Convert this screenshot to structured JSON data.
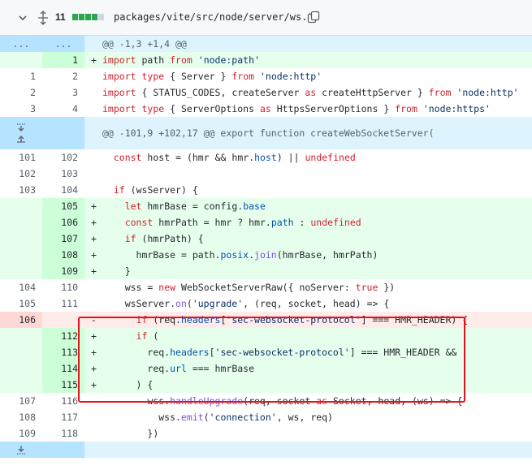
{
  "file": {
    "changed_count": "11",
    "diff_bar": [
      "green",
      "green",
      "green",
      "green",
      "gray"
    ],
    "path": "packages/vite/src/node/server/ws.ts"
  },
  "colors": {
    "add_bg": "#e6ffec",
    "del_bg": "#ffebe9",
    "hunk_bg": "#ddf4ff",
    "highlight": "#e5121b"
  },
  "rows": [
    {
      "kind": "hunk",
      "old": "...",
      "new": "...",
      "marker": "",
      "text": "@@ -1,3 +1,4 @@",
      "expander": "none"
    },
    {
      "kind": "add",
      "old": "",
      "new": "1",
      "marker": "+",
      "text": "import path from 'node:path'"
    },
    {
      "kind": "ctx",
      "old": "1",
      "new": "2",
      "marker": "",
      "text": "import type { Server } from 'node:http'"
    },
    {
      "kind": "ctx",
      "old": "2",
      "new": "3",
      "marker": "",
      "text": "import { STATUS_CODES, createServer as createHttpServer } from 'node:http'"
    },
    {
      "kind": "ctx",
      "old": "3",
      "new": "4",
      "marker": "",
      "text": "import type { ServerOptions as HttpsServerOptions } from 'node:https'"
    },
    {
      "kind": "hunk",
      "old": "",
      "new": "",
      "marker": "",
      "text": "@@ -101,9 +102,17 @@ export function createWebSocketServer(",
      "expander": "both"
    },
    {
      "kind": "ctx",
      "old": "101",
      "new": "102",
      "marker": "",
      "text": "  const host = (hmr && hmr.host) || undefined"
    },
    {
      "kind": "ctx",
      "old": "102",
      "new": "103",
      "marker": "",
      "text": ""
    },
    {
      "kind": "ctx",
      "old": "103",
      "new": "104",
      "marker": "",
      "text": "  if (wsServer) {"
    },
    {
      "kind": "add",
      "old": "",
      "new": "105",
      "marker": "+",
      "text": "    let hmrBase = config.base"
    },
    {
      "kind": "add",
      "old": "",
      "new": "106",
      "marker": "+",
      "text": "    const hmrPath = hmr ? hmr.path : undefined"
    },
    {
      "kind": "add",
      "old": "",
      "new": "107",
      "marker": "+",
      "text": "    if (hmrPath) {"
    },
    {
      "kind": "add",
      "old": "",
      "new": "108",
      "marker": "+",
      "text": "      hmrBase = path.posix.join(hmrBase, hmrPath)"
    },
    {
      "kind": "add",
      "old": "",
      "new": "109",
      "marker": "+",
      "text": "    }"
    },
    {
      "kind": "ctx",
      "old": "104",
      "new": "110",
      "marker": "",
      "text": "    wss = new WebSocketServerRaw({ noServer: true })"
    },
    {
      "kind": "ctx",
      "old": "105",
      "new": "111",
      "marker": "",
      "text": "    wsServer.on('upgrade', (req, socket, head) => {"
    },
    {
      "kind": "del",
      "old": "106",
      "new": "",
      "marker": "-",
      "text": "      if (req.headers['sec-websocket-protocol'] === HMR_HEADER) {"
    },
    {
      "kind": "add",
      "old": "",
      "new": "112",
      "marker": "+",
      "text": "      if ("
    },
    {
      "kind": "add",
      "old": "",
      "new": "113",
      "marker": "+",
      "text": "        req.headers['sec-websocket-protocol'] === HMR_HEADER &&"
    },
    {
      "kind": "add",
      "old": "",
      "new": "114",
      "marker": "+",
      "text": "        req.url === hmrBase"
    },
    {
      "kind": "add",
      "old": "",
      "new": "115",
      "marker": "+",
      "text": "      ) {"
    },
    {
      "kind": "ctx",
      "old": "107",
      "new": "116",
      "marker": "",
      "text": "        wss.handleUpgrade(req, socket as Socket, head, (ws) => {"
    },
    {
      "kind": "ctx",
      "old": "108",
      "new": "117",
      "marker": "",
      "text": "          wss.emit('connection', ws, req)"
    },
    {
      "kind": "ctx",
      "old": "109",
      "new": "118",
      "marker": "",
      "text": "        })"
    },
    {
      "kind": "hunk",
      "old": "",
      "new": "",
      "marker": "",
      "text": "",
      "expander": "down"
    }
  ]
}
